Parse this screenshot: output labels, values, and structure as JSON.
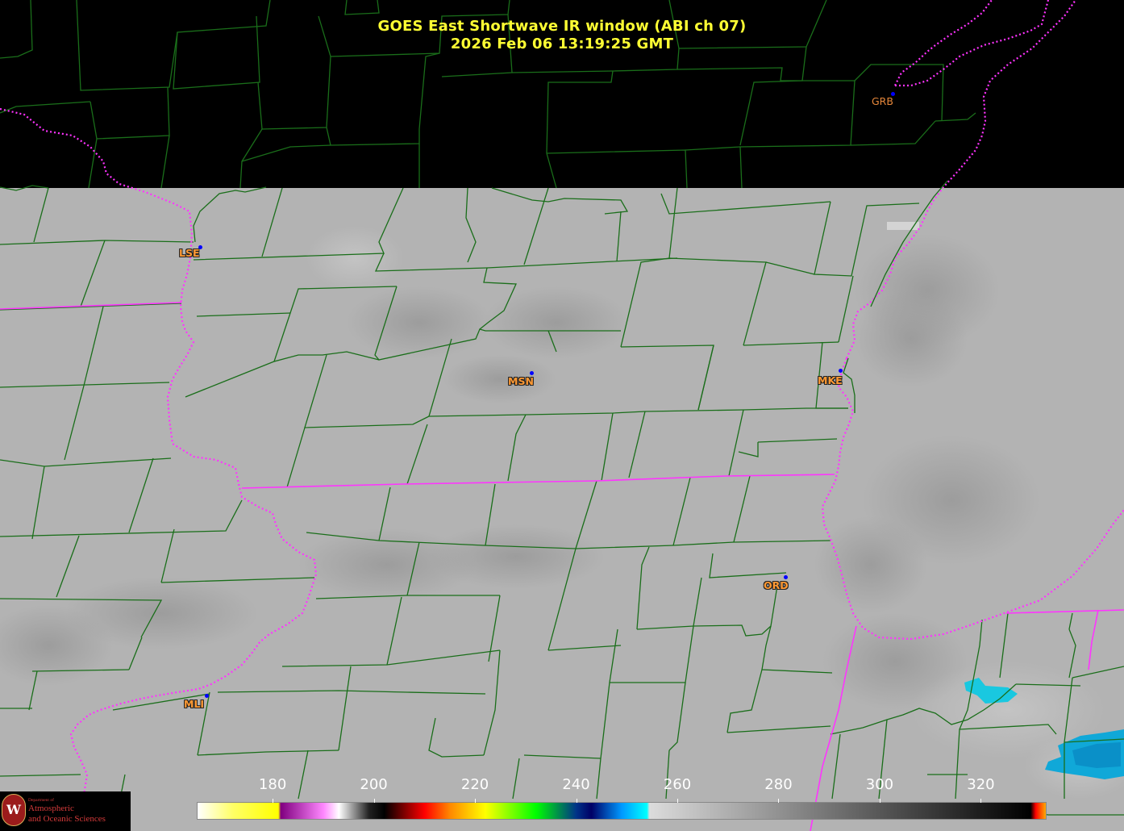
{
  "title": {
    "line1": "GOES East Shortwave IR window (ABI ch 07)",
    "line2": "2026 Feb 06  13:19:25 GMT",
    "color": "#ffff33"
  },
  "stations": [
    {
      "id": "GRB",
      "lon": -88.13,
      "lat": 44.48
    },
    {
      "id": "LSE",
      "lon": -91.26,
      "lat": 43.88
    },
    {
      "id": "MSN",
      "lon": -89.35,
      "lat": 43.14
    },
    {
      "id": "MKE",
      "lon": -87.9,
      "lat": 42.95
    },
    {
      "id": "ORD",
      "lon": -87.9,
      "lat": 41.98
    },
    {
      "id": "MLI",
      "lon": -90.51,
      "lat": 41.45
    }
  ],
  "colorbar": {
    "unit_min": 165,
    "unit_max": 333,
    "ticks": [
      "180",
      "200",
      "220",
      "240",
      "260",
      "280",
      "300",
      "320"
    ],
    "stops": [
      {
        "t": 165,
        "color": "#ffffff"
      },
      {
        "t": 172,
        "color": "#ffff66"
      },
      {
        "t": 181,
        "color": "#ffff00"
      },
      {
        "t": 181.5,
        "color": "#800080"
      },
      {
        "t": 190,
        "color": "#ff88ff"
      },
      {
        "t": 193,
        "color": "#ffffff"
      },
      {
        "t": 199,
        "color": "#202020"
      },
      {
        "t": 202,
        "color": "#000000"
      },
      {
        "t": 210,
        "color": "#ff0000"
      },
      {
        "t": 215,
        "color": "#ff8800"
      },
      {
        "t": 222,
        "color": "#ffff00"
      },
      {
        "t": 232,
        "color": "#00ff00"
      },
      {
        "t": 240,
        "color": "#003388"
      },
      {
        "t": 243,
        "color": "#000066"
      },
      {
        "t": 249,
        "color": "#0099ff"
      },
      {
        "t": 254,
        "color": "#00ffff"
      },
      {
        "t": 254.5,
        "color": "#dcdcdc"
      },
      {
        "t": 330,
        "color": "#000000"
      },
      {
        "t": 331,
        "color": "#ff0000"
      },
      {
        "t": 333,
        "color": "#ffaa00"
      }
    ]
  },
  "colors": {
    "county_lines": "#1a6e1a",
    "state_lines": "#ff33ff",
    "no_data": "#000000",
    "cloud_gray": "#b4b4b4"
  },
  "logo": {
    "dept": "Department of",
    "name1": "Atmospheric",
    "name2": "and Oceanic Sciences",
    "seal": "W"
  }
}
